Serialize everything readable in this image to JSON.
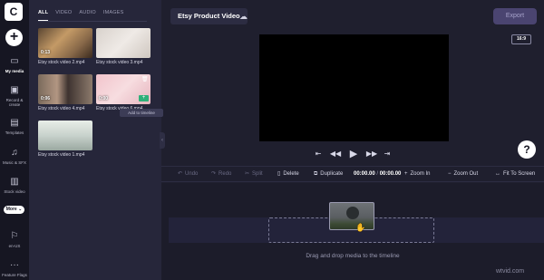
{
  "app": {
    "logo_letter": "C"
  },
  "rail": {
    "add_label": "+",
    "items": [
      {
        "id": "my-media",
        "label": "My media",
        "icon": "folder-icon",
        "glyph": "▭"
      },
      {
        "id": "record",
        "label": "Record & create",
        "icon": "camera-icon",
        "glyph": "▣"
      },
      {
        "id": "templates",
        "label": "Templates",
        "icon": "templates-icon",
        "glyph": "▤"
      },
      {
        "id": "music",
        "label": "Music & SFX",
        "icon": "music-icon",
        "glyph": "♫"
      },
      {
        "id": "stock",
        "label": "Stock video",
        "icon": "film-icon",
        "glyph": "▥"
      },
      {
        "id": "locale",
        "label": "en-US",
        "icon": "flag-icon",
        "glyph": "⚐"
      },
      {
        "id": "flags",
        "label": "Feature Flags",
        "icon": "more-dots-icon",
        "glyph": "···"
      }
    ],
    "more_label": "More ⌄"
  },
  "library": {
    "tabs": [
      "ALL",
      "VIDEO",
      "AUDIO",
      "IMAGES"
    ],
    "active_tab": "ALL",
    "items": [
      {
        "name": "Etsy stock video 2.mp4",
        "duration": "0:13"
      },
      {
        "name": "Etsy stock video 3.mp4",
        "duration": ""
      },
      {
        "name": "Etsy stock video 4.mp4",
        "duration": "0:06"
      },
      {
        "name": "Etsy stock video 6.mp4",
        "duration": "0:00"
      },
      {
        "name": "Etsy stock video 1.mp4",
        "duration": ""
      }
    ],
    "tooltip": "Add to timeline",
    "collapse_glyph": "‹"
  },
  "header": {
    "project_title": "Etsy Product Video",
    "export_label": "Export",
    "aspect_ratio": "16:9"
  },
  "player": {
    "controls": [
      "⇤",
      "◀◀",
      "▶",
      "▶▶",
      "⇥"
    ]
  },
  "toolbar": {
    "undo": "Undo",
    "redo": "Redo",
    "split": "Split",
    "delete": "Delete",
    "duplicate": "Duplicate",
    "time_current": "00:00.00",
    "time_separator": "/",
    "time_total": "00:00.00",
    "zoom_in": "Zoom In",
    "zoom_out": "Zoom Out",
    "fit": "Fit To Screen"
  },
  "timeline": {
    "drop_hint": "Drag and drop media to the timeline"
  },
  "help_label": "?",
  "watermark": "wtvid.com"
}
